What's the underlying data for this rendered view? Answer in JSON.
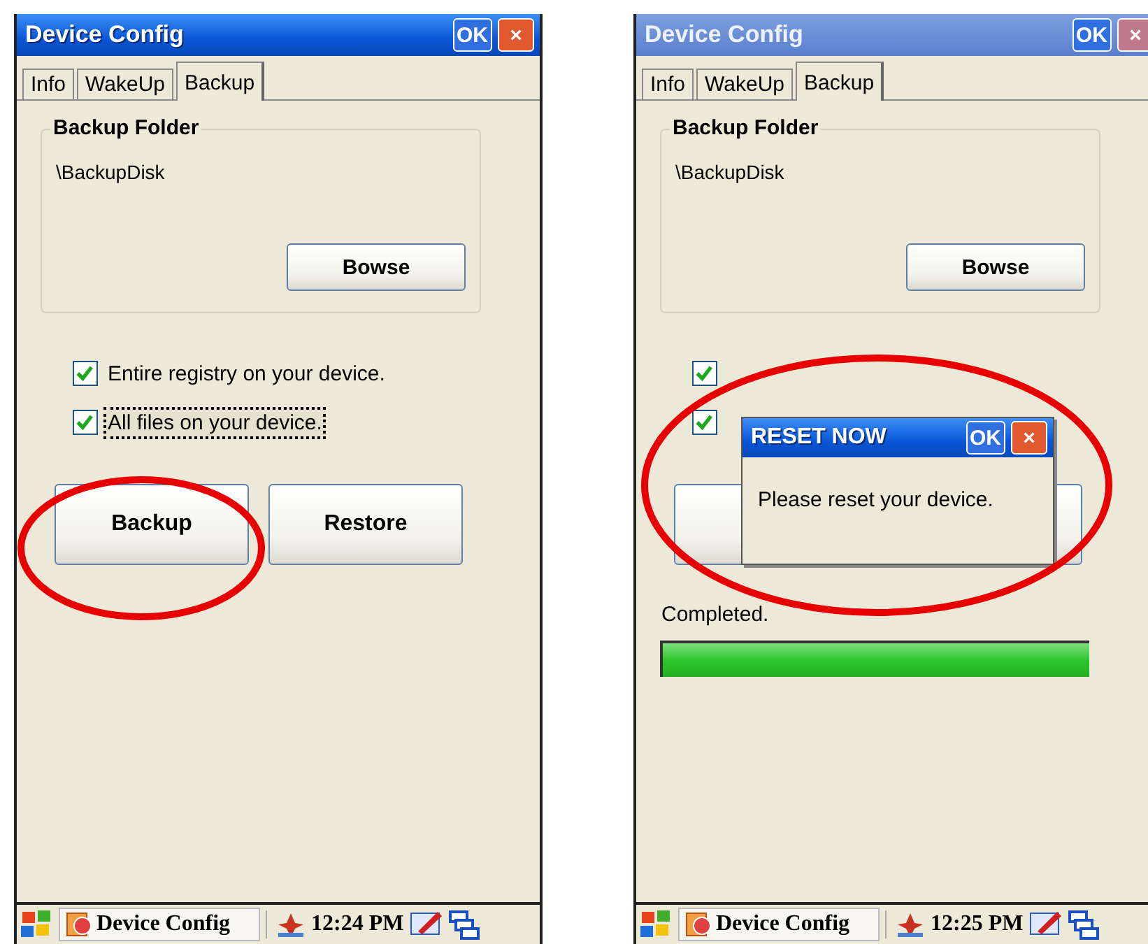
{
  "screens": [
    {
      "window": {
        "title": "Device Config",
        "active": true,
        "buttons": [
          "OK",
          "×"
        ]
      },
      "tabs": [
        {
          "label": "Info",
          "selected": false
        },
        {
          "label": "WakeUp",
          "selected": false
        },
        {
          "label": "Backup",
          "selected": true
        }
      ],
      "backup_folder": {
        "title": "Backup Folder",
        "path": "\\BackupDisk",
        "browse_button": "Bowse"
      },
      "options": [
        {
          "label": "Entire registry on your device.",
          "checked": true,
          "focused": false
        },
        {
          "label": "All files on your device.",
          "checked": true,
          "focused": true
        }
      ],
      "actions": [
        {
          "label": "Backup",
          "circled": true
        },
        {
          "label": "Restore",
          "circled": false
        }
      ],
      "taskbar": {
        "app": "Device Config",
        "time": "12:24 PM"
      }
    },
    {
      "window": {
        "title": "Device Config",
        "active": false,
        "buttons": [
          "OK",
          "×"
        ]
      },
      "tabs": [
        {
          "label": "Info",
          "selected": false
        },
        {
          "label": "WakeUp",
          "selected": false
        },
        {
          "label": "Backup",
          "selected": true
        }
      ],
      "backup_folder": {
        "title": "Backup Folder",
        "path": "\\BackupDisk",
        "browse_button": "Bowse"
      },
      "options": [
        {
          "checked": true
        },
        {
          "checked": true
        }
      ],
      "actions": [
        {
          "circled": false
        },
        {
          "circled": false
        }
      ],
      "status": "Completed.",
      "progress": {
        "level": 1
      },
      "dialog": {
        "title": "RESET NOW",
        "buttons": [
          "OK",
          "×"
        ],
        "message": "Please reset your device.",
        "circled": true
      },
      "taskbar": {
        "app": "Device Config",
        "time": "12:25 PM"
      }
    }
  ]
}
